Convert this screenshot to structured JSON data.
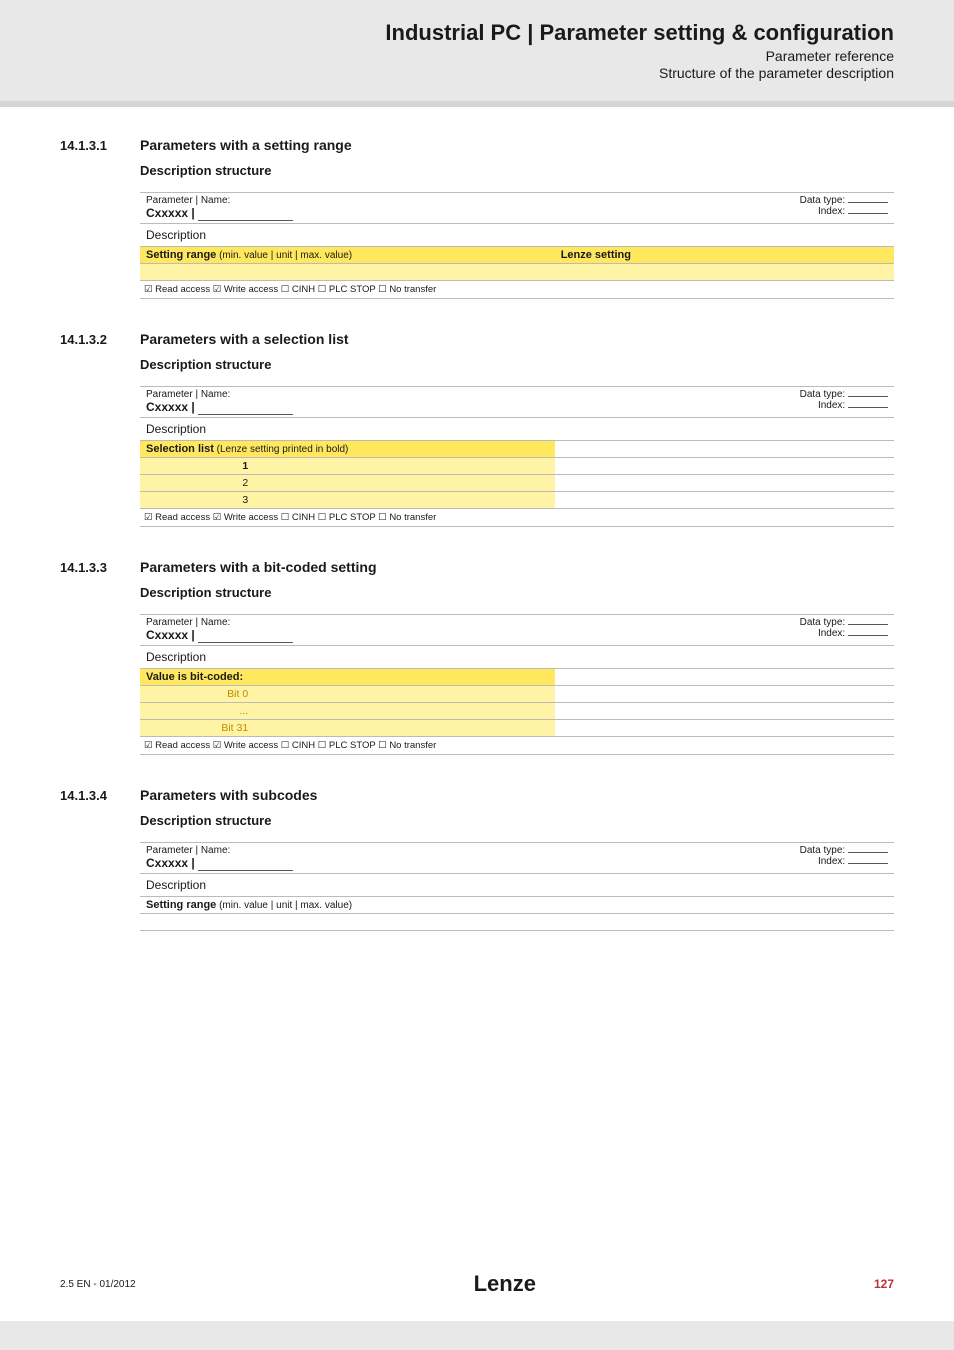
{
  "header": {
    "title": "Industrial PC | Parameter setting & configuration",
    "sub1": "Parameter reference",
    "sub2": "Structure of the parameter description"
  },
  "sections": [
    {
      "num": "14.1.3.1",
      "title": "Parameters with a setting range",
      "sub": "Description structure"
    },
    {
      "num": "14.1.3.2",
      "title": "Parameters with a selection list",
      "sub": "Description structure"
    },
    {
      "num": "14.1.3.3",
      "title": "Parameters with a bit-coded setting",
      "sub": "Description structure"
    },
    {
      "num": "14.1.3.4",
      "title": "Parameters with subcodes",
      "sub": "Description structure"
    }
  ],
  "labels": {
    "param_name": "Parameter | Name:",
    "code": "Cxxxxx | ",
    "datatype": "Data type:",
    "index": "Index:",
    "description": "Description",
    "setting_range": "Setting range",
    "setting_range_sub": " (min. value | unit | max. value)",
    "lenze_setting": "Lenze setting",
    "selection_list": "Selection list",
    "selection_list_sub": " (Lenze setting printed in bold)",
    "bitcoded": "Value is bit-coded:",
    "bit0": "Bit 0",
    "bitdots": "...",
    "bit31": "Bit 31",
    "sel1": "1",
    "sel2": "2",
    "sel3": "3",
    "access": "☑ Read access   ☑ Write access   ☐ CINH   ☐ PLC STOP   ☐ No transfer"
  },
  "footer": {
    "left": "2.5 EN - 01/2012",
    "brand": "Lenze",
    "page": "127"
  }
}
